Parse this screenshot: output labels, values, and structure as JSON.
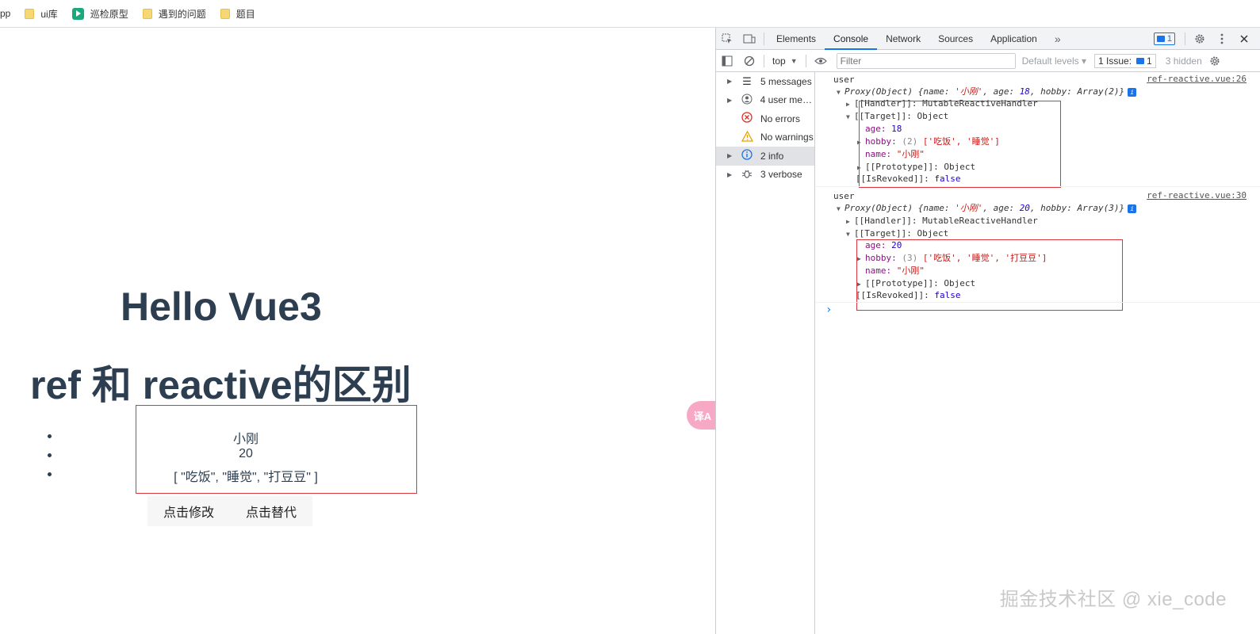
{
  "bookmarks": [
    {
      "label": "pp",
      "icon": "none"
    },
    {
      "label": "ui库",
      "icon": "folder-icon"
    },
    {
      "label": "巡检原型",
      "icon": "play-icon"
    },
    {
      "label": "遇到的问题",
      "icon": "folder-icon"
    },
    {
      "label": "题目",
      "icon": "folder-icon"
    }
  ],
  "page": {
    "title": "Hello Vue3",
    "subtitle": "ref 和 reactive的区别",
    "list": [
      "小刚",
      "20",
      "[ \"吃饭\", \"睡觉\", \"打豆豆\" ]"
    ],
    "buttons": {
      "modify": "点击修改",
      "replace": "点击替代"
    },
    "translate_badge": "译A"
  },
  "devtools": {
    "tabs": [
      "Elements",
      "Console",
      "Network",
      "Sources",
      "Application"
    ],
    "active_tab": "Console",
    "more_tabs": "»",
    "message_count": "1",
    "toolbar": {
      "context": "top",
      "filter_placeholder": "Filter",
      "levels": "Default levels ▾",
      "issues_label": "1 Issue:",
      "issues_count": "1",
      "hidden": "3 hidden"
    },
    "sidebar": [
      {
        "label": "5 messages",
        "icon": "list-icon",
        "expandable": true
      },
      {
        "label": "4 user mes...",
        "icon": "user-icon",
        "expandable": true
      },
      {
        "label": "No errors",
        "icon": "error-icon",
        "expandable": false
      },
      {
        "label": "No warnings",
        "icon": "warning-icon",
        "expandable": false
      },
      {
        "label": "2 info",
        "icon": "info-icon",
        "expandable": true,
        "selected": true
      },
      {
        "label": "3 verbose",
        "icon": "bug-icon",
        "expandable": true
      }
    ],
    "logs": [
      {
        "label": "user",
        "source": "ref-reactive.vue:26",
        "summary": {
          "prefix": "Proxy(Object) {name: ",
          "name": "'小刚'",
          "age_key": ", age: ",
          "age": "18",
          "hobby_key": ", hobby: ",
          "hobby": "Array(2)",
          "suffix": "}"
        },
        "handler": "[[Handler]]: MutableReactiveHandler",
        "target": "[[Target]]: Object",
        "age_label": "age: ",
        "age_value": "18",
        "hobby_label": "hobby: ",
        "hobby_count": "(2) ",
        "hobby_values": "['吃饭', '睡觉']",
        "name_label": "name: ",
        "name_value": "\"小刚\"",
        "prototype": "[[Prototype]]: Object",
        "revoked_label": "[[IsRevoked]]: ",
        "revoked_value": "false"
      },
      {
        "label": "user",
        "source": "ref-reactive.vue:30",
        "summary": {
          "prefix": "Proxy(Object) {name: ",
          "name": "'小刚'",
          "age_key": ", age: ",
          "age": "20",
          "hobby_key": ", hobby: ",
          "hobby": "Array(3)",
          "suffix": "}"
        },
        "handler": "[[Handler]]: MutableReactiveHandler",
        "target": "[[Target]]: Object",
        "age_label": "age: ",
        "age_value": "20",
        "hobby_label": "hobby: ",
        "hobby_count": "(3) ",
        "hobby_values": "['吃饭', '睡觉', '打豆豆']",
        "name_label": "name: ",
        "name_value": "\"小刚\"",
        "prototype": "[[Prototype]]: Object",
        "revoked_label": "[[IsRevoked]]: ",
        "revoked_value": "false"
      }
    ],
    "prompt": "›"
  },
  "watermark": "掘金技术社区 @ xie_code",
  "colors": {
    "heading": "#2c3e50",
    "highlight_box": "#d9363e",
    "accent": "#1a73e8"
  }
}
